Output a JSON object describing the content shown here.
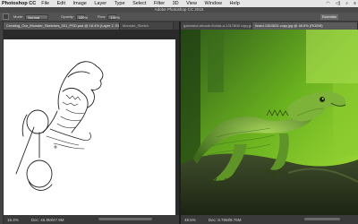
{
  "menubar": {
    "app_name": "Photoshop CC",
    "items": [
      "File",
      "Edit",
      "Image",
      "Layer",
      "Type",
      "Select",
      "Filter",
      "3D",
      "View",
      "Window",
      "Help"
    ]
  },
  "window": {
    "title": "Adobe Photoshop CC 2015"
  },
  "options": {
    "mode_label": "Mode:",
    "mode_value": "Normal",
    "opacity_label": "Opacity:",
    "opacity_value": "100%",
    "flow_label": "Flow:",
    "flow_value": "100%",
    "workspace": "Essentials"
  },
  "tabs_left": [
    {
      "label": "Creating_Our_Monster_Sketches_001_PSD.psd @ 16.4% (Layer 2, RGB/8) *"
    },
    {
      "label": "Monster_Sketch"
    }
  ],
  "tabs_right": [
    {
      "label": "galarland-arkade-florida-a-1317808 copy.jpg"
    },
    {
      "label": "lizard-1364524 copy.jpg @ 48.5% (RGB/8)"
    }
  ],
  "status_left": {
    "zoom": "16.4%",
    "doc": "Doc: 46.8M/47.9M"
  },
  "status_right": {
    "zoom": "48.5%",
    "doc": "Doc: 8.76M/8.76M"
  },
  "colors": {
    "menubar": "#e6e6e6",
    "panel": "#535353",
    "canvas": "#ffffff",
    "photo_green": "#4fa32a"
  }
}
